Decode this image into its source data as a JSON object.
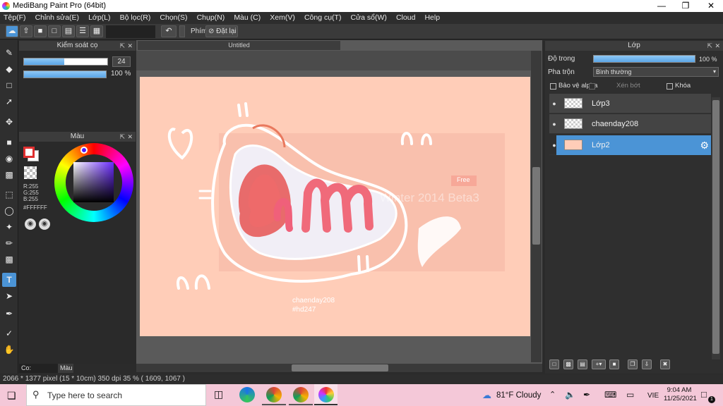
{
  "app": {
    "title": "MediBang Paint Pro (64bit)"
  },
  "menu": [
    "Tệp(F)",
    "Chỉnh sửa(E)",
    "Lớp(L)",
    "Bộ lọc(R)",
    "Chọn(S)",
    "Chụp(N)",
    "Màu (C)",
    "Xem(V)",
    "Công cụ(T)",
    "Cửa sổ(W)",
    "Cloud",
    "Help"
  ],
  "toolbar": {
    "keys_label": "Phím",
    "reset_label": "Đặt lại"
  },
  "brush_panel": {
    "title": "Kiểm soát cọ",
    "size_value": "24",
    "size_fill": 0.48,
    "opacity_value": "100 %",
    "opacity_fill": 1.0
  },
  "color_panel": {
    "title": "Màu",
    "r": "R:255",
    "g": "G:255",
    "b": "B:255",
    "hex": "#FFFFFF"
  },
  "bottom_tabs": {
    "brush_tab": "Co: NONAME",
    "color_tab": "Màu"
  },
  "document": {
    "tab_title": "Untitled",
    "watermark_badge": "Free",
    "watermark_text": "Winter 2014 Beta3",
    "credit_line1": "chaenday208",
    "credit_line2": "#hd247"
  },
  "layer_panel": {
    "title": "Lớp",
    "opacity_label": "Độ trong",
    "opacity_value": "100 %",
    "opacity_fill": 1.0,
    "blend_label": "Pha trộn",
    "blend_value": "Bình thường",
    "protect_alpha": "Bảo vệ alpha",
    "clipping": "Xén bớt",
    "lock": "Khóa",
    "layers": [
      {
        "name": "Lớp3",
        "selected": false
      },
      {
        "name": "chaenday208",
        "selected": false
      },
      {
        "name": "Lớp2",
        "selected": true
      }
    ]
  },
  "status": {
    "text": "2066 * 1377 pixel   (15 * 10cm)   350 dpi   35 %   ( 1609, 1067 )"
  },
  "taskbar": {
    "search_placeholder": "Type here to search",
    "weather": "81°F  Cloudy",
    "lang": "VIE",
    "time": "9:04 AM",
    "date": "11/25/2021",
    "notif_count": "1"
  },
  "colors": {
    "selection_blue": "#4b94d6",
    "canvas_bg": "#ffcdb8",
    "taskbar_pink": "#f4c8d8"
  }
}
